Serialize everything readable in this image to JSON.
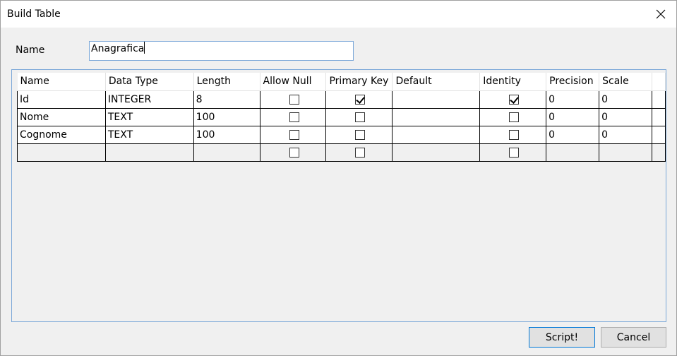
{
  "window": {
    "title": "Build Table"
  },
  "form": {
    "name_label": "Name",
    "name_value": "Anagrafica"
  },
  "grid": {
    "columns": [
      "Name",
      "Data Type",
      "Length",
      "Allow Null",
      "Primary Key",
      "Default",
      "Identity",
      "Precision",
      "Scale"
    ],
    "rows": [
      {
        "name": "Id",
        "data_type": "INTEGER",
        "length": "8",
        "allow_null": false,
        "primary_key": true,
        "default": "",
        "identity": true,
        "precision": "0",
        "scale": "0"
      },
      {
        "name": "Nome",
        "data_type": "TEXT",
        "length": "100",
        "allow_null": false,
        "primary_key": false,
        "default": "",
        "identity": false,
        "precision": "0",
        "scale": "0"
      },
      {
        "name": "Cognome",
        "data_type": "TEXT",
        "length": "100",
        "allow_null": false,
        "primary_key": false,
        "default": "",
        "identity": false,
        "precision": "0",
        "scale": "0"
      },
      {
        "name": "",
        "data_type": "",
        "length": "",
        "allow_null": false,
        "primary_key": false,
        "default": "",
        "identity": false,
        "precision": "",
        "scale": ""
      }
    ]
  },
  "buttons": {
    "script_label": "Script!",
    "cancel_label": "Cancel"
  },
  "icons": {
    "close": "close-icon",
    "checkbox": "checkbox"
  }
}
